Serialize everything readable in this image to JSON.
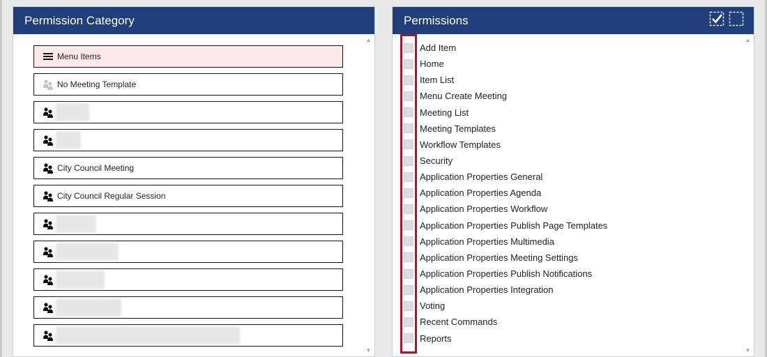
{
  "left_panel": {
    "title": "Permission Category",
    "items": [
      {
        "label": "Menu Items",
        "icon": "menu-icon",
        "selected": true
      },
      {
        "label": "No Meeting Template",
        "icon": "users-gray-icon"
      },
      {
        "label": "",
        "icon": "users-icon",
        "redacted": true
      },
      {
        "label": "",
        "icon": "users-icon",
        "redacted": true
      },
      {
        "label": "City Council Meeting",
        "icon": "users-icon"
      },
      {
        "label": "City Council Regular Session",
        "icon": "users-icon"
      },
      {
        "label": "",
        "icon": "users-icon",
        "redacted": true
      },
      {
        "label": "",
        "icon": "users-icon",
        "redacted": true
      },
      {
        "label": "",
        "icon": "users-icon",
        "redacted": true
      },
      {
        "label": "",
        "icon": "users-icon",
        "redacted": true
      },
      {
        "label": "",
        "icon": "users-icon",
        "redacted": true
      }
    ]
  },
  "right_panel": {
    "title": "Permissions",
    "header_buttons": [
      "select-all-icon",
      "deselect-all-icon"
    ],
    "items": [
      "Add Item",
      "Home",
      "Item List",
      "Menu Create Meeting",
      "Meeting List",
      "Meeting Templates",
      "Workflow Templates",
      "Security",
      "Application Properties General",
      "Application Properties Agenda",
      "Application Properties Workflow",
      "Application Properties Publish Page Templates",
      "Application Properties Multimedia",
      "Application Properties Meeting Settings",
      "Application Properties Publish Notifications",
      "Application Properties Integration",
      "Voting",
      "Recent Commands",
      "Reports"
    ]
  },
  "colors": {
    "header_bg": "#1f3e7a",
    "selected_bg": "#fde9e9",
    "highlight_box": "#b0122a",
    "checkbox": "#dcdcdc"
  }
}
